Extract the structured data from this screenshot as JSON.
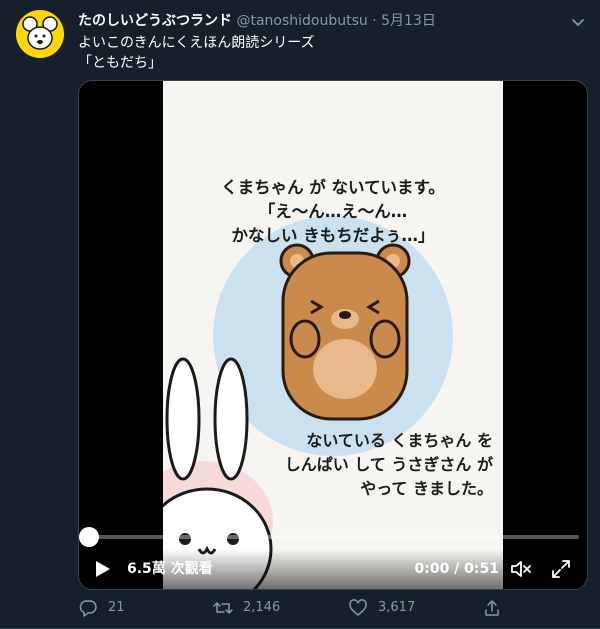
{
  "tweet": {
    "author_name": "たのしいどうぶつランド",
    "handle": "@tanoshidoubutsu",
    "separator": "·",
    "date": "5月13日",
    "text_lines": [
      "よいこのきんにくえほん朗読シリーズ",
      "「ともだち」"
    ]
  },
  "video": {
    "caption_top": [
      "くまちゃん が ないています。",
      "「え〜ん…え〜ん…",
      "かなしい きもちだよぅ…」"
    ],
    "caption_bottom": [
      "ないている くまちゃん を",
      "しんぱい して うさぎさん が",
      "やって きました。"
    ],
    "views_label": "6.5萬 次觀看",
    "time_label": "0:00 / 0:51",
    "progress": 0.0,
    "icons": {
      "play": "play-icon",
      "volume": "volume-muted-icon",
      "fullscreen": "fullscreen-icon"
    }
  },
  "actions": {
    "reply_count": "21",
    "retweet_count": "2,146",
    "like_count": "3,617",
    "icons": [
      "reply-icon",
      "retweet-icon",
      "like-icon",
      "share-icon"
    ]
  },
  "colors": {
    "background": "#15202b",
    "secondary_text": "#8899a6",
    "avatar_bg": "#ffd60a"
  }
}
